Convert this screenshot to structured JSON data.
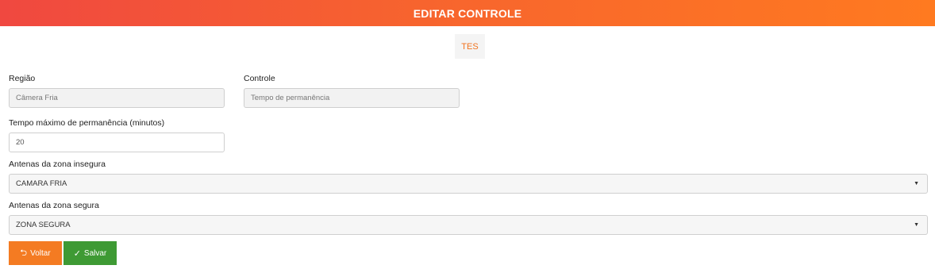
{
  "header": {
    "title": "EDITAR CONTROLE"
  },
  "tab": {
    "label": "TES"
  },
  "form": {
    "region": {
      "label": "Região",
      "value": "Câmera Fria"
    },
    "control": {
      "label": "Controle",
      "value": "Tempo de permanência"
    },
    "max_time": {
      "label": "Tempo máximo de permanência (minutos)",
      "value": "20"
    },
    "unsafe_antennas": {
      "label": "Antenas da zona insegura",
      "selected": "CAMARA FRIA"
    },
    "safe_antennas": {
      "label": "Antenas da zona segura",
      "selected": "ZONA SEGURA"
    }
  },
  "buttons": {
    "back": {
      "label": "Voltar",
      "icon": "return-icon"
    },
    "save": {
      "label": "Salvar",
      "icon": "check-icon"
    }
  },
  "colors": {
    "header_start": "#f04840",
    "header_end": "#ff7a20",
    "accent": "#f27420",
    "back_button": "#f47b22",
    "save_button": "#3e9a34"
  }
}
